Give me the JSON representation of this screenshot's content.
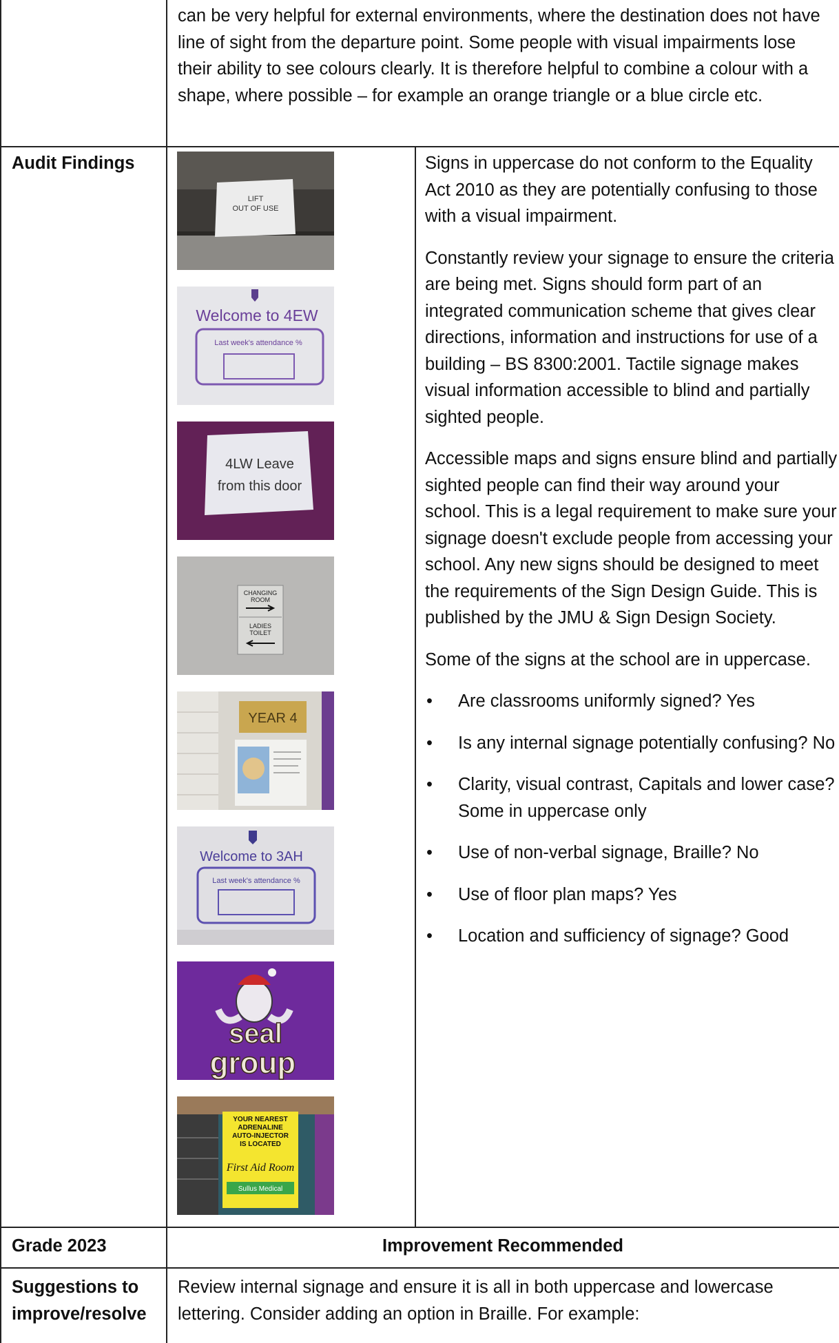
{
  "intro": {
    "text": "can be very helpful for external environments, where the destination does not have line of sight from the departure point. Some people with visual impairments lose their ability to see colours clearly. It is therefore helpful to combine a colour with a shape, where possible – for example an orange triangle or a blue circle etc."
  },
  "findings": {
    "label": "Audit Findings",
    "paragraphs": [
      "Signs in uppercase do not conform to the Equality Act 2010 as they are potentially confusing to those with a visual impairment.",
      " Constantly review your signage to ensure the criteria are being met.  Signs should form part of an integrated communication scheme that gives clear directions, information and instructions for use of a building – BS 8300:2001. Tactile signage makes visual information accessible to blind and partially sighted people.",
      "Accessible maps and signs ensure blind and partially sighted people can find their way around your school. This is a legal requirement to make sure your signage doesn't exclude people from accessing your school. Any new signs should be designed to meet the requirements of the Sign Design Guide. This is published by the JMU & Sign Design Society.",
      "Some of the signs at the school are in uppercase."
    ],
    "bullets": [
      "Are classrooms uniformly signed? Yes",
      " Is any internal signage potentially confusing? No",
      "Clarity, visual contrast, Capitals and lower case? Some in uppercase only",
      "Use of non-verbal signage, Braille? No",
      "Use of floor plan maps? Yes",
      "Location and sufficiency of signage? Good"
    ],
    "photos": {
      "lift": [
        "LIFT",
        "OUT OF USE"
      ],
      "welcome4": {
        "title": "Welcome to 4EW",
        "sub": "Last week's attendance %"
      },
      "leave": [
        "4LW Leave",
        "from this door"
      ],
      "changing": [
        "CHANGING",
        "ROOM",
        "LADIES",
        "TOILET"
      ],
      "year4": "YEAR 4",
      "welcome3": {
        "title": "Welcome to 3AH",
        "sub": "Last week's attendance %"
      },
      "seal": [
        "seal",
        "group"
      ],
      "adrenaline": [
        "YOUR NEAREST",
        "ADRENALINE",
        "AUTO-INJECTOR",
        "IS LOCATED",
        "First Aid Room",
        "Sullus Medical"
      ]
    }
  },
  "grade": {
    "label": "Grade 2023",
    "value": "Improvement Recommended"
  },
  "suggestions": {
    "label_line1": "Suggestions to",
    "label_line2": "improve/resolve",
    "text": "Review internal signage and ensure it is all in both uppercase and lowercase lettering. Consider adding an option in Braille. For example:"
  }
}
